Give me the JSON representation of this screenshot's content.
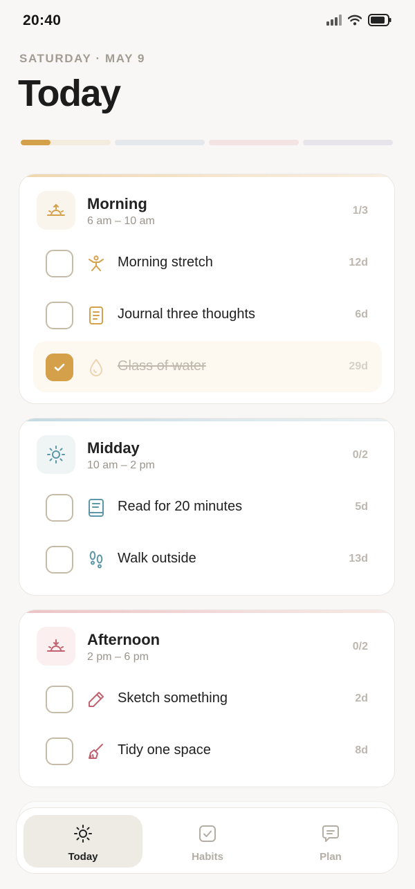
{
  "status": {
    "time": "20:40"
  },
  "header": {
    "date": "SATURDAY · MAY 9",
    "title": "Today"
  },
  "progress": [
    {
      "part": "morning",
      "fraction": 0.333,
      "color": "#d4a04a",
      "track": "#f3ecdf"
    },
    {
      "part": "midday",
      "fraction": 0,
      "color": "#6aa3b4",
      "track": "#e5e8ea"
    },
    {
      "part": "afternoon",
      "fraction": 0,
      "color": "#c9737f",
      "track": "#f3e4e3"
    },
    {
      "part": "evening",
      "fraction": 0,
      "color": "#9a97ad",
      "track": "#e7e5ea"
    }
  ],
  "sections": [
    {
      "title": "Morning",
      "time": "6 am – 10 am",
      "count": "1/3",
      "icon": "sunrise-icon",
      "accent": "#efd6b0",
      "icon_bg": "#faf5ec",
      "color": "#d4a04a",
      "habits": [
        {
          "label": "Morning stretch",
          "streak": "12d",
          "icon": "stretch-icon",
          "done": false
        },
        {
          "label": "Journal three thoughts",
          "streak": "6d",
          "icon": "journal-icon",
          "done": false
        },
        {
          "label": "Glass of water",
          "streak": "29d",
          "icon": "water-drop-icon",
          "done": true
        }
      ]
    },
    {
      "title": "Midday",
      "time": "10 am – 2 pm",
      "count": "0/2",
      "icon": "sun-icon",
      "accent": "#cfe1e7",
      "icon_bg": "#eff4f5",
      "color": "#5c97a8",
      "habits": [
        {
          "label": "Read for 20 minutes",
          "streak": "5d",
          "icon": "book-icon",
          "done": false
        },
        {
          "label": "Walk outside",
          "streak": "13d",
          "icon": "footprints-icon",
          "done": false
        }
      ]
    },
    {
      "title": "Afternoon",
      "time": "2 pm – 6 pm",
      "count": "0/2",
      "icon": "sunset-icon",
      "accent": "#f0cfd2",
      "icon_bg": "#fbf0ef",
      "color": "#c2616f",
      "habits": [
        {
          "label": "Sketch something",
          "streak": "2d",
          "icon": "pencil-icon",
          "done": false
        },
        {
          "label": "Tidy one space",
          "streak": "8d",
          "icon": "broom-icon",
          "done": false
        }
      ]
    }
  ],
  "tabs": [
    {
      "label": "Today",
      "icon": "sun-icon",
      "active": true
    },
    {
      "label": "Habits",
      "icon": "checkbox-icon",
      "active": false
    },
    {
      "label": "Plan",
      "icon": "chat-icon",
      "active": false
    }
  ]
}
